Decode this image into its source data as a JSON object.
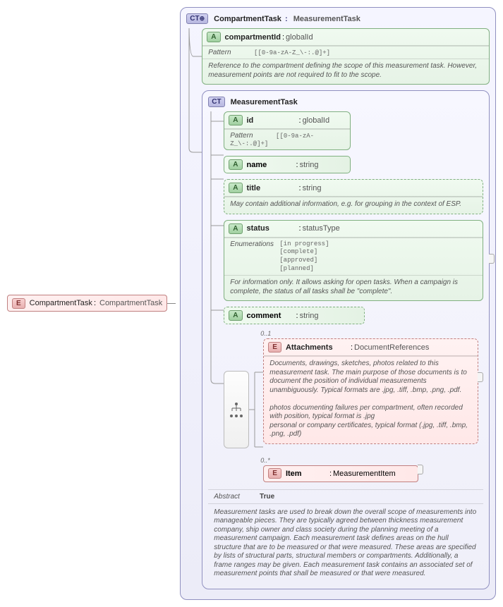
{
  "root": {
    "name": "CompartmentTask",
    "type": "CompartmentTask"
  },
  "outer": {
    "badge": "CT",
    "name": "CompartmentTask",
    "type": "MeasurementTask"
  },
  "compartmentId": {
    "name": "compartmentId",
    "type": "globalId",
    "pattern_label": "Pattern",
    "pattern": "[[0-9a-zA-Z_\\-:.@]+]",
    "description": "Reference to the compartment defining the scope of this measurement task. However, measurement points are not required to fit to the scope."
  },
  "inner": {
    "badge": "CT",
    "name": "MeasurementTask"
  },
  "id": {
    "name": "id",
    "type": "globalId",
    "pattern_label": "Pattern",
    "pattern": "[[0-9a-zA-Z_\\-:.@]+]"
  },
  "nameAttr": {
    "name": "name",
    "type": "string"
  },
  "title": {
    "name": "title",
    "type": "string",
    "description": "May contain additional information, e.g. for grouping in the context of ESP."
  },
  "status": {
    "name": "status",
    "type": "statusType",
    "enum_label": "Enumerations",
    "enums": [
      "[in progress]",
      "[complete]",
      "[approved]",
      "[planned]"
    ],
    "description": "For information only. It allows asking for open tasks. When a campaign is complete, the status of all tasks shall be \"complete\"."
  },
  "comment": {
    "name": "comment",
    "type": "string"
  },
  "attachments": {
    "occurs": "0..1",
    "name": "Attachments",
    "type": "DocumentReferences",
    "description": "Documents, drawings, sketches, photos related to this measurement task. The main purpose of those documents is to document the position of individual measurements unambiguously. Typical formats are .jpg, .tiff, .bmp, .png, .pdf.\n\n    photos documenting failures per compartment, often recorded with position, typical format is .jpg\n    personal or company certificates, typical format (.jpg, .tiff, .bmp, .png, .pdf)"
  },
  "item": {
    "occurs": "0..*",
    "name": "Item",
    "type": "MeasurementItem"
  },
  "abstract": {
    "label": "Abstract",
    "value": "True"
  },
  "footer": "Measurement tasks are used to break down the overall scope of measurements into manageable pieces. They are typically agreed between thickness measurement company, ship owner and class society during the planning meeting of a measurement campaign. Each measurement task defines areas on the hull structure that are to be measured or that were measured. These areas are specified by lists of structural parts, structural members or compartments. Additionally, a frame ranges may be given. Each measurement task contains an associated set of measurement points that shall be measured or that were measured.",
  "badges": {
    "E": "E",
    "A": "A",
    "CT": "CT",
    "CTp": "CT"
  }
}
